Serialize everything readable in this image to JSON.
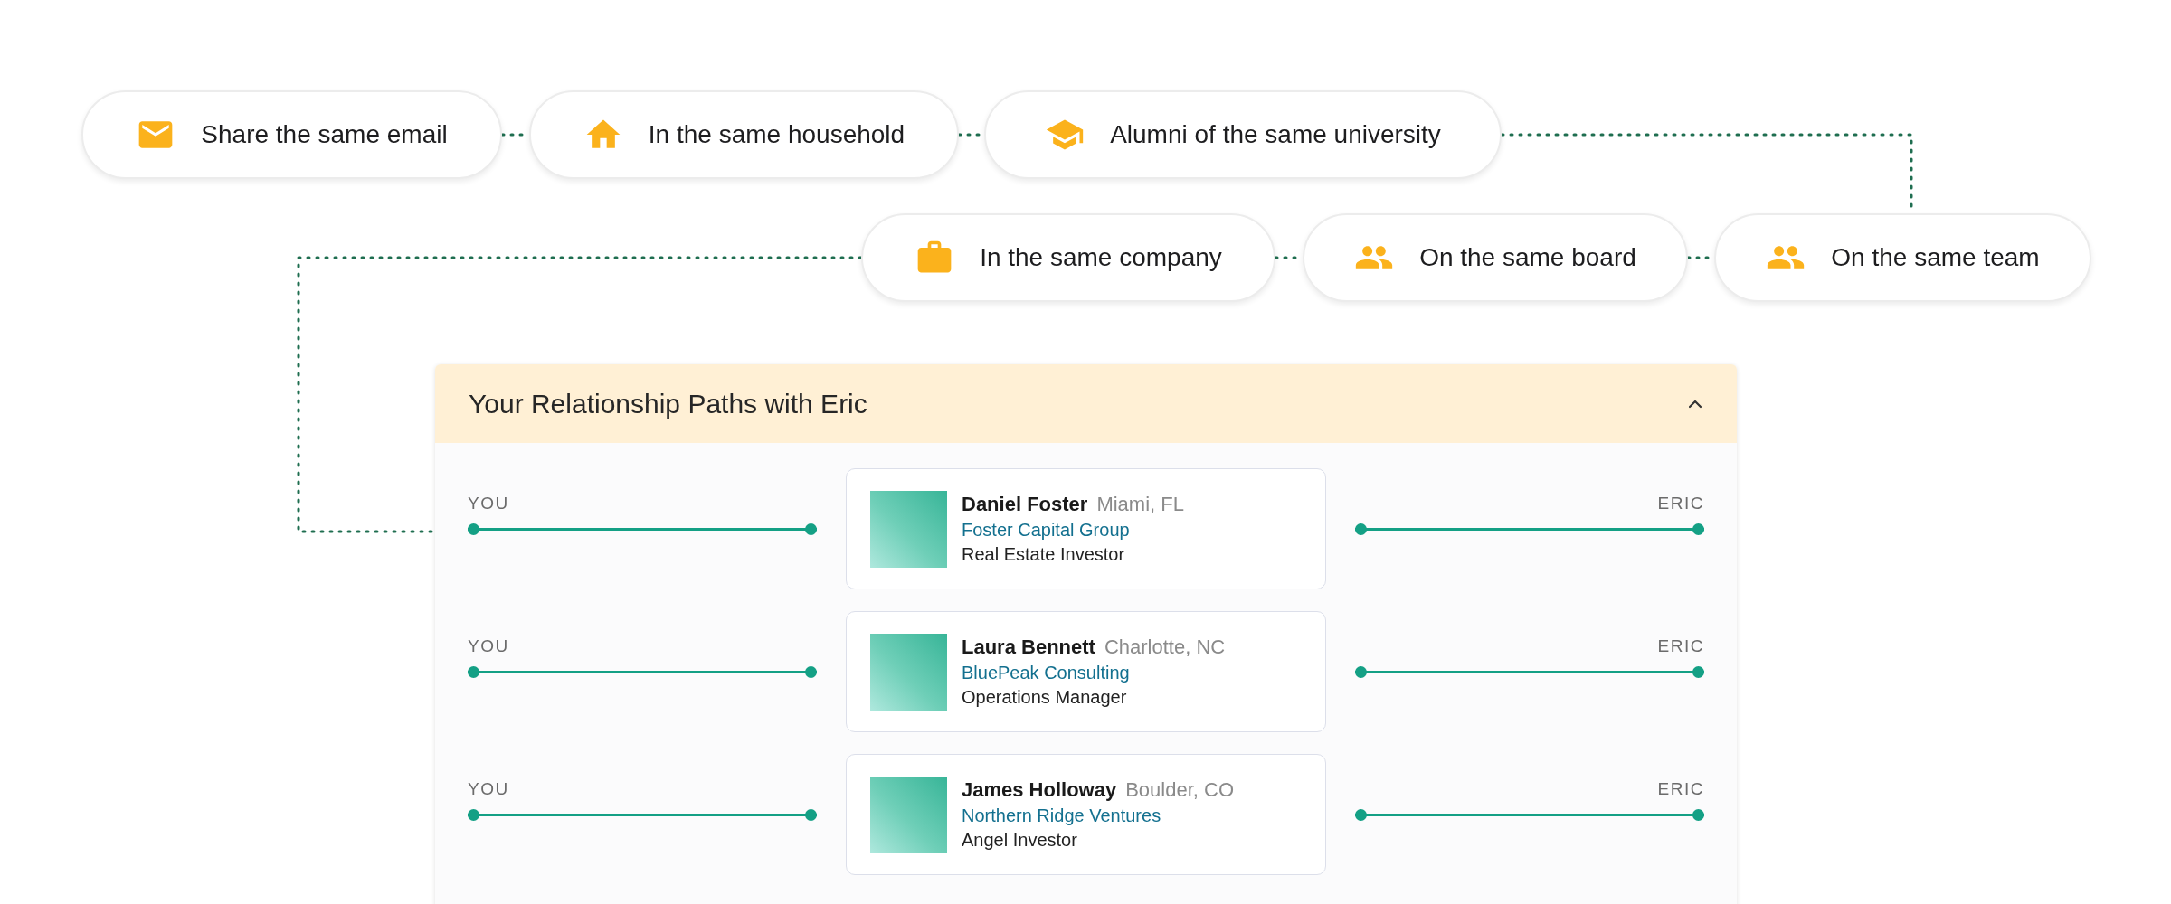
{
  "relations_row_1": [
    {
      "label": "Share the same email"
    },
    {
      "label": "In the same household"
    },
    {
      "label": "Alumni of the same university"
    }
  ],
  "relations_row_2": [
    {
      "label": "In the same company"
    },
    {
      "label": "On the same board"
    },
    {
      "label": "On the same team"
    }
  ],
  "panel": {
    "title": "Your Relationship Paths with Eric",
    "expanded": true,
    "paths": [
      {
        "start": "YOU",
        "end": "ERIC",
        "name": "Daniel Foster",
        "location": "Miami, FL",
        "company": "Foster Capital Group",
        "role": "Real Estate Investor"
      },
      {
        "start": "YOU",
        "end": "ERIC",
        "name": "Laura Bennett",
        "location": "Charlotte, NC",
        "company": "BluePeak Consulting",
        "role": "Operations Manager"
      },
      {
        "start": "YOU",
        "end": "ERIC",
        "name": "James Holloway",
        "location": "Boulder, CO",
        "company": "Northern Ridge Ventures",
        "role": "Angel Investor"
      }
    ]
  }
}
